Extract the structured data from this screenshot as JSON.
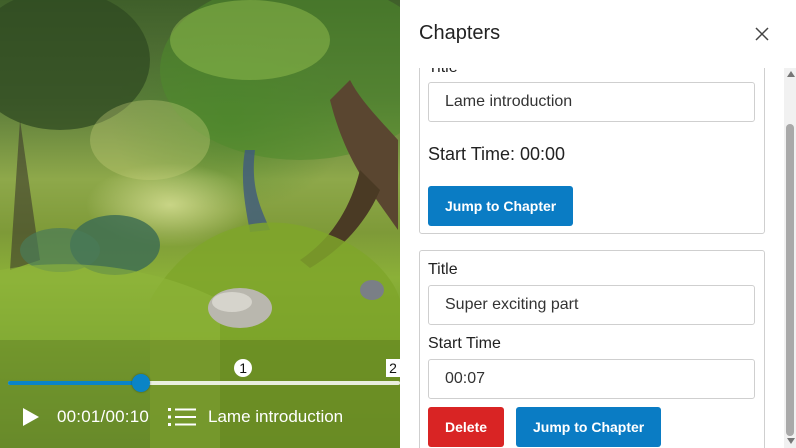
{
  "player": {
    "time_display": "00:01/00:10",
    "current_chapter": "Lame introduction",
    "progress_fraction": 0.34,
    "markers": [
      {
        "label": "1",
        "fraction": 0.6
      },
      {
        "label": "2",
        "fraction": 1.0
      }
    ],
    "accent_color": "#0a84c6"
  },
  "panel": {
    "title": "Chapters",
    "chapters": [
      {
        "title_label": "Title",
        "title_value": "Lame introduction",
        "start_time_text": "Start Time: 00:00",
        "jump_label": "Jump to Chapter"
      },
      {
        "title_label": "Title",
        "title_value": "Super exciting part",
        "start_time_label": "Start Time",
        "start_time_value": "00:07",
        "delete_label": "Delete",
        "jump_label": "Jump to Chapter"
      }
    ]
  },
  "icons": {
    "play": "play-icon",
    "chapters": "chapters-list-icon",
    "close": "close-icon"
  },
  "colors": {
    "primary_button": "#0a7cc4",
    "danger_button": "#d92424"
  }
}
